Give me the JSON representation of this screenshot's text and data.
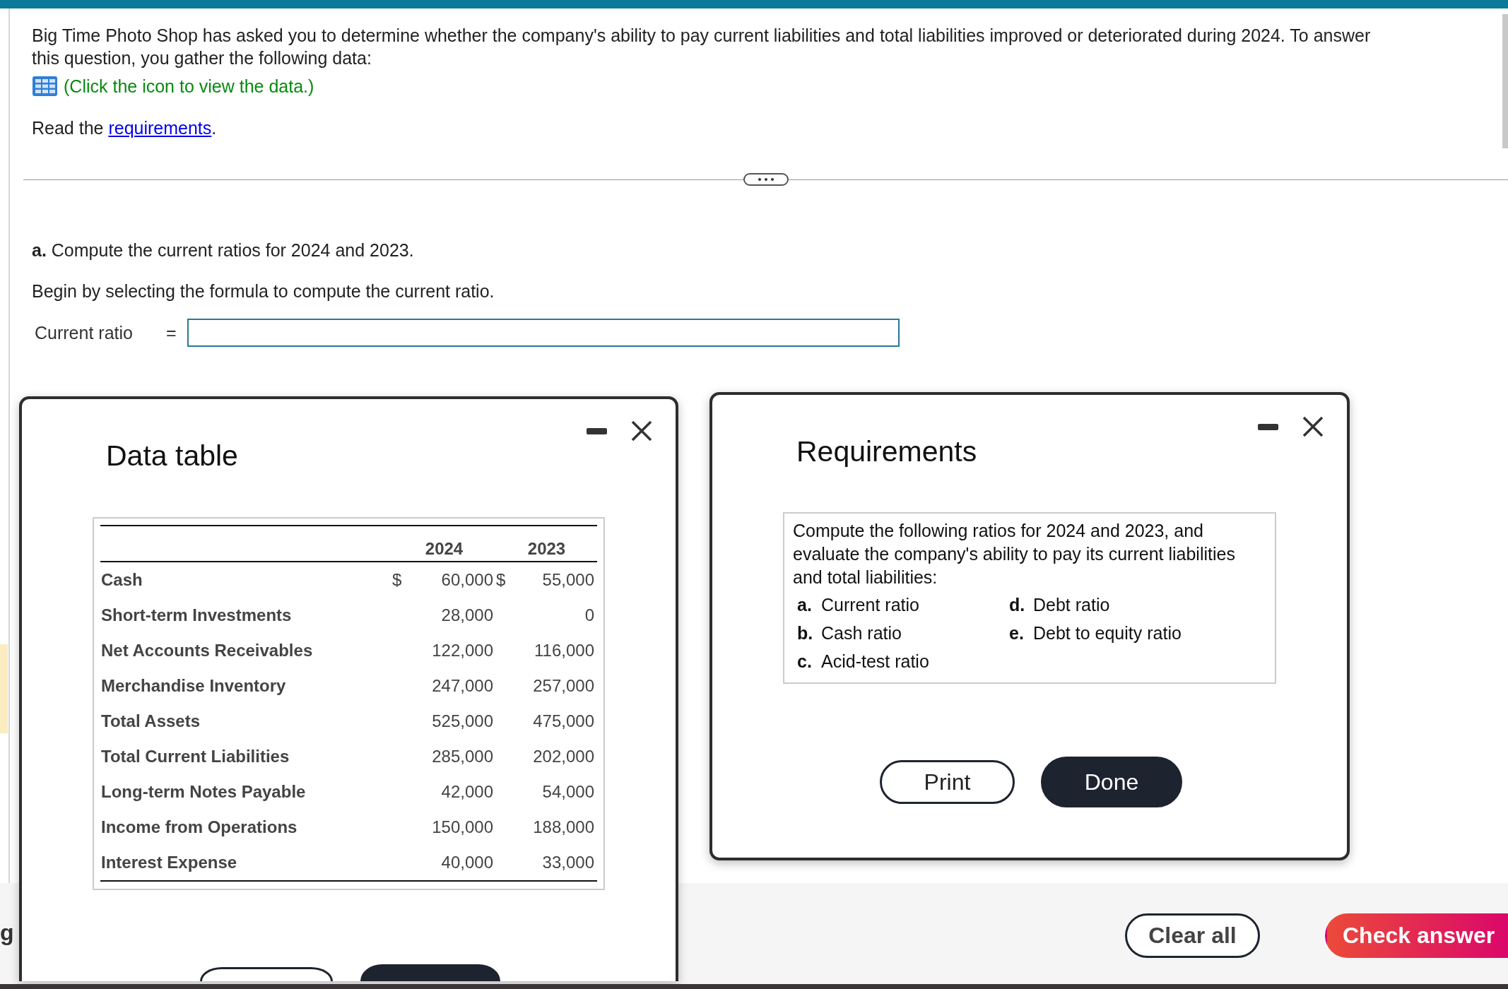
{
  "question": {
    "text": "Big Time Photo Shop has asked you to determine whether the company's ability to pay current liabilities and total liabilities improved or deteriorated during 2024. To answer this question, you gather the following data:",
    "data_link": "(Click the icon to view the data.)",
    "read_prefix": "Read the",
    "requirements_link": "requirements",
    "read_suffix": "."
  },
  "part_a": {
    "label": "a.",
    "text": "Compute the current ratios for 2024 and 2023.",
    "instruction": "Begin by selecting the formula to compute the current ratio.",
    "formula_label": "Current ratio",
    "equals": "="
  },
  "side_fragment": "g",
  "data_table": {
    "title": "Data table",
    "columns": [
      "2024",
      "2023"
    ],
    "rows": [
      {
        "label": "Cash",
        "cells": [
          {
            "symbol": "$",
            "value": "60,000"
          },
          {
            "symbol": "$",
            "value": "55,000"
          }
        ]
      },
      {
        "label": "Short-term Investments",
        "cells": [
          {
            "value": "28,000"
          },
          {
            "value": "0"
          }
        ]
      },
      {
        "label": "Net Accounts Receivables",
        "cells": [
          {
            "value": "122,000"
          },
          {
            "value": "116,000"
          }
        ]
      },
      {
        "label": "Merchandise Inventory",
        "cells": [
          {
            "value": "247,000"
          },
          {
            "value": "257,000"
          }
        ]
      },
      {
        "label": "Total Assets",
        "cells": [
          {
            "value": "525,000"
          },
          {
            "value": "475,000"
          }
        ]
      },
      {
        "label": "Total Current Liabilities",
        "cells": [
          {
            "value": "285,000"
          },
          {
            "value": "202,000"
          }
        ]
      },
      {
        "label": "Long-term Notes Payable",
        "cells": [
          {
            "value": "42,000"
          },
          {
            "value": "54,000"
          }
        ]
      },
      {
        "label": "Income from Operations",
        "cells": [
          {
            "value": "150,000"
          },
          {
            "value": "188,000"
          }
        ]
      },
      {
        "label": "Interest Expense",
        "cells": [
          {
            "value": "40,000"
          },
          {
            "value": "33,000"
          }
        ]
      }
    ],
    "buttons": [
      {
        "kind": "outline"
      },
      {
        "kind": "primary"
      }
    ]
  },
  "requirements": {
    "title": "Requirements",
    "intro": "Compute the following ratios for 2024 and 2023, and evaluate the company's ability to pay its current liabilities and total liabilities:",
    "items": [
      {
        "letter": "a.",
        "text": "Current ratio"
      },
      {
        "letter": "b.",
        "text": "Cash ratio"
      },
      {
        "letter": "c.",
        "text": "Acid-test ratio"
      },
      {
        "letter": "d.",
        "text": "Debt ratio"
      },
      {
        "letter": "e.",
        "text": "Debt to equity ratio"
      }
    ],
    "buttons": [
      {
        "label": "Print",
        "kind": "outline"
      },
      {
        "label": "Done",
        "kind": "primary"
      }
    ]
  },
  "footer": {
    "buttons": [
      {
        "label": "Clear all",
        "kind": "outline"
      },
      {
        "label": "Check answer",
        "kind": "accent"
      }
    ]
  }
}
